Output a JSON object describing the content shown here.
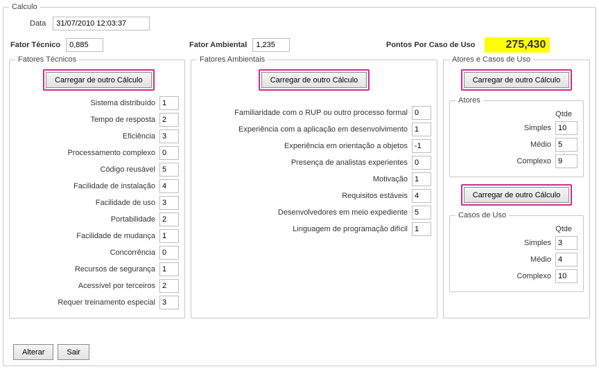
{
  "window": {
    "title": "Calculo"
  },
  "header": {
    "date_label": "Data",
    "date_value": "31/07/2010 12:03:37"
  },
  "summary": {
    "tech_label": "Fator Técnico",
    "tech_value": "0,885",
    "env_label": "Fator Ambiental",
    "env_value": "1,235",
    "pcu_label": "Pontos Por Caso de Uso",
    "pcu_value": "275,430"
  },
  "buttons": {
    "load_other": "Carregar de outro Cálculo",
    "alterar": "Alterar",
    "sair": "Sair"
  },
  "tech": {
    "legend": "Fatores Técnicos",
    "rows": [
      {
        "label": "Sistema distribuído",
        "value": "1"
      },
      {
        "label": "Tempo de resposta",
        "value": "2"
      },
      {
        "label": "Eficiência",
        "value": "3"
      },
      {
        "label": "Processamento complexo",
        "value": "0"
      },
      {
        "label": "Código reusável",
        "value": "5"
      },
      {
        "label": "Facilidade de instalação",
        "value": "4"
      },
      {
        "label": "Facilidade de uso",
        "value": "3"
      },
      {
        "label": "Portabilidade",
        "value": "2"
      },
      {
        "label": "Facilidade de mudança",
        "value": "1"
      },
      {
        "label": "Concorrência",
        "value": "0"
      },
      {
        "label": "Recursos de segurança",
        "value": "1"
      },
      {
        "label": "Acessível por terceiros",
        "value": "2"
      },
      {
        "label": "Requer treinamento especial",
        "value": "3"
      }
    ]
  },
  "env": {
    "legend": "Fatores Ambientais",
    "rows": [
      {
        "label": "Familiaridade com o RUP ou outro processo formal",
        "value": "0"
      },
      {
        "label": "Experiência com a aplicação em desenvolvimento",
        "value": "1"
      },
      {
        "label": "Experiência em orientação a objetos",
        "value": "-1"
      },
      {
        "label": "Presença de analistas experientes",
        "value": "0"
      },
      {
        "label": "Motivação",
        "value": "1"
      },
      {
        "label": "Requisitos estáveis",
        "value": "4"
      },
      {
        "label": "Desenvolvedores em meio expediente",
        "value": "5"
      },
      {
        "label": "Linguagem de programação difícil",
        "value": "1"
      }
    ]
  },
  "actors_cases": {
    "legend": "Atores e Casos de Uso",
    "qtde": "Qtde",
    "actors": {
      "legend": "Atores",
      "rows": [
        {
          "label": "Simples",
          "value": "10"
        },
        {
          "label": "Médio",
          "value": "5"
        },
        {
          "label": "Complexo",
          "value": "9"
        }
      ]
    },
    "cases": {
      "legend": "Casos de Uso",
      "rows": [
        {
          "label": "Simples",
          "value": "3"
        },
        {
          "label": "Médio",
          "value": "4"
        },
        {
          "label": "Complexo",
          "value": "10"
        }
      ]
    }
  }
}
